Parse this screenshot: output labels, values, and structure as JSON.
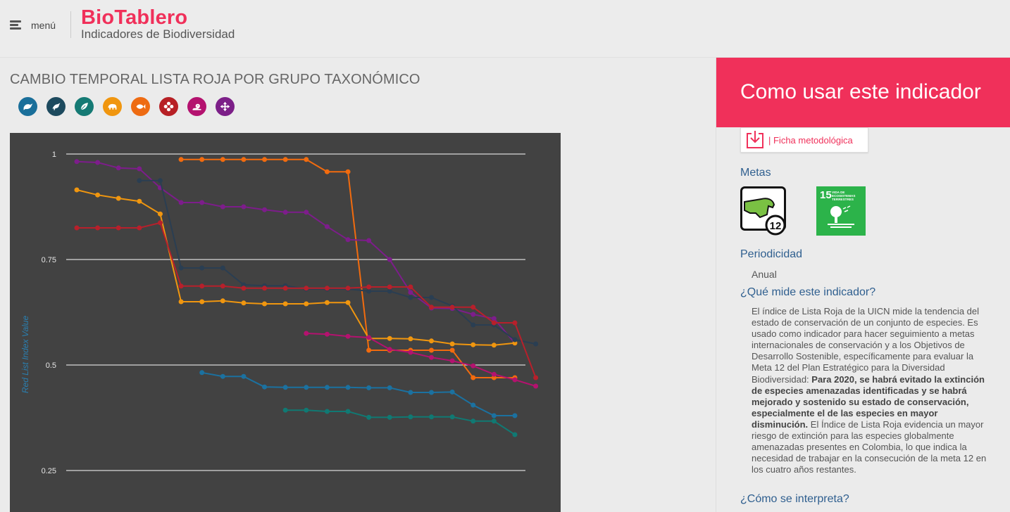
{
  "header": {
    "menu_label": "menú",
    "brand_title": "BioTablero",
    "brand_subtitle": "Indicadores de Biodiversidad"
  },
  "main": {
    "chart_title": "CAMBIO TEMPORAL LISTA ROJA POR GRUPO TAXONÓMICO",
    "taxa_buttons": [
      {
        "icon": "bird-icon",
        "color": "#1a6f9a"
      },
      {
        "icon": "crow-icon",
        "color": "#1d4a5e"
      },
      {
        "icon": "leaf-icon",
        "color": "#157a74"
      },
      {
        "icon": "mammal-icon",
        "color": "#f0960f"
      },
      {
        "icon": "fish-icon",
        "color": "#ee6b12"
      },
      {
        "icon": "flower-icon",
        "color": "#b72025"
      },
      {
        "icon": "reptile-icon",
        "color": "#b4126f"
      },
      {
        "icon": "arrows-icon",
        "color": "#7c1f88"
      }
    ]
  },
  "chart_data": {
    "type": "line",
    "ylabel": "Red List Index Value",
    "ylim": [
      0.2,
      1.05
    ],
    "yticks": [
      {
        "label": "1",
        "value": 1.0
      },
      {
        "label": "0.75",
        "value": 0.75
      },
      {
        "label": "0.5",
        "value": 0.5
      },
      {
        "label": "0.25",
        "value": 0.25
      }
    ],
    "grid": true,
    "series": [
      {
        "color": "#f26b0e",
        "values": [
          null,
          null,
          null,
          null,
          null,
          0.987,
          0.987,
          0.987,
          0.987,
          0.987,
          0.987,
          0.987,
          0.958,
          0.958,
          0.535,
          0.535,
          0.535,
          0.535,
          0.535,
          0.47,
          0.47,
          0.47
        ]
      },
      {
        "color": "#7d1d8b",
        "values": [
          0.982,
          0.98,
          0.967,
          0.965,
          0.92,
          0.885,
          0.885,
          0.875,
          0.875,
          0.868,
          0.862,
          0.862,
          0.828,
          0.797,
          0.795,
          0.75,
          0.672,
          0.635,
          0.634,
          0.62,
          0.61,
          0.552
        ]
      },
      {
        "color": "#f0960f",
        "values": [
          0.915,
          0.903,
          0.895,
          0.888,
          0.858,
          0.65,
          0.65,
          0.652,
          0.647,
          0.645,
          0.645,
          0.645,
          0.648,
          0.648,
          0.563,
          0.563,
          0.562,
          0.557,
          0.55,
          0.548,
          0.547,
          0.552
        ]
      },
      {
        "color": "#2a3e52",
        "values": [
          null,
          null,
          null,
          0.937,
          0.937,
          0.73,
          0.73,
          0.73,
          0.69,
          0.688,
          0.688,
          0.68,
          0.68,
          0.68,
          0.675,
          0.675,
          0.66,
          0.66,
          0.64,
          0.595,
          0.595,
          0.56,
          0.55
        ]
      },
      {
        "color": "#b7202b",
        "values": [
          0.825,
          0.825,
          0.825,
          0.825,
          0.837,
          0.687,
          0.687,
          0.687,
          0.682,
          0.682,
          0.682,
          0.682,
          0.682,
          0.682,
          0.685,
          0.685,
          0.685,
          0.637,
          0.637,
          0.637,
          0.6,
          0.6,
          0.47
        ]
      },
      {
        "color": "#b4126f",
        "values": [
          null,
          null,
          null,
          null,
          null,
          null,
          null,
          null,
          null,
          null,
          null,
          0.575,
          0.573,
          0.568,
          0.565,
          0.537,
          0.53,
          0.518,
          0.51,
          0.498,
          0.478,
          0.465,
          0.45
        ]
      },
      {
        "color": "#1b71a0",
        "values": [
          null,
          null,
          null,
          null,
          null,
          null,
          0.482,
          0.473,
          0.473,
          0.448,
          0.447,
          0.447,
          0.447,
          0.447,
          0.446,
          0.446,
          0.435,
          0.435,
          0.436,
          0.405,
          0.38,
          0.38
        ]
      },
      {
        "color": "#107973",
        "values": [
          null,
          null,
          null,
          null,
          null,
          null,
          null,
          null,
          null,
          null,
          0.393,
          0.393,
          0.39,
          0.39,
          0.376,
          0.376,
          0.377,
          0.377,
          0.377,
          0.367,
          0.367,
          0.335
        ]
      }
    ]
  },
  "panel": {
    "heading": "Como usar este indicador",
    "ficha_label": "| Ficha metodológica",
    "metas_title": "Metas",
    "meta_badge_number": "12",
    "sdg_number": "15",
    "sdg_label": "VIDA DE ECOSISTEMAS TERRESTRES",
    "periodicidad_title": "Periodicidad",
    "periodicidad_value": "Anual",
    "que_mide_title": "¿Qué mide este indicador?",
    "desc_part1": "El índice de Lista Roja de la UICN mide la tendencia del estado de conservación de un conjunto de especies. Es usado como indicador para hacer seguimiento a metas internacionales de conservación y a los Objetivos de Desarrollo Sostenible, específicamente para evaluar la Meta 12 del Plan Estratégico para la Diversidad Biodiversidad: ",
    "desc_bold": "Para 2020, se habrá evitado la extinción de especies amenazadas identificadas y se habrá mejorado y sostenido su estado de conservación, especialmente el de las especies en mayor disminución.",
    "desc_part2": " El Índice de Lista Roja evidencia un mayor riesgo de extinción para las especies globalmente amenazadas presentes en Colombia, lo que indica la necesidad de trabajar en la consecución de la meta 12 en los cuatro años restantes.",
    "como_title": "¿Cómo se interpreta?"
  }
}
